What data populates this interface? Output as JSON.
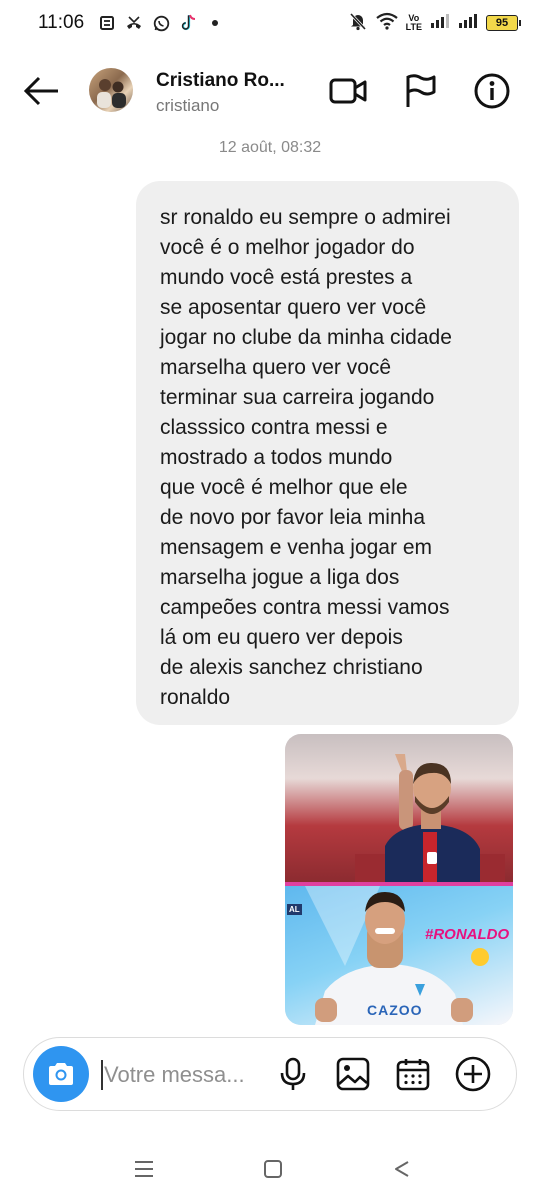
{
  "status_bar": {
    "time": "11:06",
    "volte_top": "Vo",
    "volte_bottom": "LTE",
    "battery": "95",
    "battery_color": "#f2d84a"
  },
  "header": {
    "name": "Cristiano Ro...",
    "handle": "cristiano",
    "icons": [
      "back-arrow-icon",
      "video-camera-icon",
      "flag-icon",
      "info-icon"
    ]
  },
  "thread": {
    "timestamp": "12 août, 08:32",
    "message_lines": [
      "sr ronaldo eu sempre o admirei",
      "você é o melhor jogador do",
      "mundo você está prestes a",
      "se aposentar quero ver você",
      "jogar no clube da minha cidade",
      "marselha quero ver você",
      "terminar sua carreira jogando",
      "classsico contra messi e",
      "mostrado a todos mundo",
      "que você é melhor que ele",
      "de novo por favor leia minha",
      "mensagem e venha jogar em",
      "marselha jogue a liga dos",
      "campeões contra messi vamos",
      "lá om eu quero ver depois",
      "de alexis sanchez christiano",
      "ronaldo"
    ],
    "image": {
      "tag": "#RONALDO",
      "brand": "CAZOO",
      "side": "AL"
    }
  },
  "composer": {
    "placeholder": "Votre messa...",
    "accent": "#2f95f0",
    "icons": [
      "camera-icon",
      "microphone-icon",
      "gallery-icon",
      "calendar-icon",
      "plus-circle-icon"
    ]
  },
  "navbar": {
    "icons": [
      "menu-icon",
      "home-square-icon",
      "back-triangle-icon"
    ]
  }
}
